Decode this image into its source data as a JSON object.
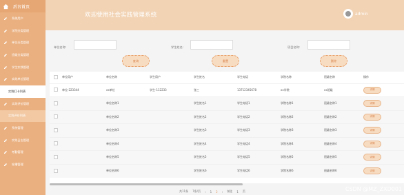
{
  "brand": {
    "label": "后台首页"
  },
  "header": {
    "title": "欢迎使用社会实践管理系统",
    "user": "admin"
  },
  "sidebar": {
    "items": [
      {
        "label": "系统用户",
        "state": "normal"
      },
      {
        "label": "学院分类管理",
        "state": "normal"
      },
      {
        "label": "单位分类管理",
        "state": "normal"
      },
      {
        "label": "班级分类管理",
        "state": "normal"
      },
      {
        "label": "学生实践管理",
        "state": "normal"
      },
      {
        "label": "实践单位管理",
        "state": "normal"
      },
      {
        "label": "实践打卡列表",
        "state": "active"
      },
      {
        "label": "实践评价管理",
        "state": "normal"
      },
      {
        "label": "实践评价列表",
        "state": "sub"
      },
      {
        "label": "系统管理",
        "state": "normal"
      },
      {
        "label": "实践日志管理",
        "state": "normal"
      },
      {
        "label": "考勤管理",
        "state": "normal"
      },
      {
        "label": "轮播管理",
        "state": "normal"
      }
    ]
  },
  "search": {
    "labels": [
      "单位名称:",
      "学生姓名:",
      "项目名称:"
    ],
    "buttons": [
      "查询",
      "重置",
      "删除"
    ]
  },
  "table": {
    "headers": [
      "",
      "单位用户",
      "单位名称",
      "学生用户",
      "学生姓名",
      "学生电话",
      "学院名称",
      "班级名称",
      "操作"
    ],
    "rows": [
      [
        "单位-223344",
        "xx单位",
        "学生-112233",
        "张三",
        "13712345678",
        "xx学院",
        "xx班级"
      ],
      [
        "",
        "单位名称1",
        "",
        "学生姓名1",
        "学生电话1",
        "学院名称1",
        "班级名称1"
      ],
      [
        "",
        "单位名称2",
        "",
        "学生姓名2",
        "学生电话2",
        "学院名称2",
        "班级名称2"
      ],
      [
        "",
        "单位名称3",
        "",
        "学生姓名3",
        "学生电话3",
        "学院名称3",
        "班级名称3"
      ],
      [
        "",
        "单位名称4",
        "",
        "学生姓名4",
        "学生电话4",
        "学院名称4",
        "班级名称4"
      ],
      [
        "",
        "单位名称5",
        "",
        "学生姓名5",
        "学生电话5",
        "学院名称5",
        "班级名称5"
      ],
      [
        "",
        "单位名称6",
        "",
        "学生姓名6",
        "学生电话6",
        "学院名称6",
        "班级名称6"
      ]
    ],
    "action": "详情"
  },
  "pager": {
    "total": "共11条",
    "per_page": "7条/页",
    "pages": [
      "1",
      "2"
    ],
    "current": "2",
    "goto_label": "前往",
    "goto_value": "1",
    "page_unit": "页"
  },
  "watermark": "CSDN @MZ_ZXD001",
  "colors": {
    "sidebar": "#eab080",
    "header": "#f2d3b4",
    "accent": "#e79a62"
  }
}
